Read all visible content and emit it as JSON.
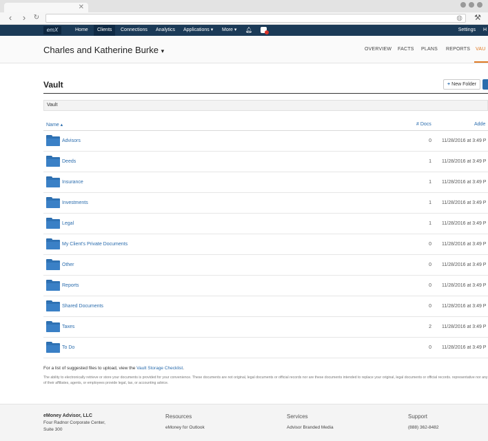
{
  "browser": {
    "address": "",
    "icons": {
      "back": "chevron-left-icon",
      "forward": "chevron-right-icon",
      "reload": "reload-icon",
      "globe": "globe-icon",
      "extension": "extension-icon"
    }
  },
  "topnav": {
    "logo": "emX",
    "items": [
      "Home",
      "Clients",
      "Connections",
      "Analytics",
      "Applications ▾",
      "More ▾"
    ],
    "active": "Clients",
    "settings": "Settings",
    "overflow": "H"
  },
  "client": {
    "name": "Charles and Katherine Burke",
    "tabs": [
      "OVERVIEW",
      "FACTS",
      "PLANS",
      "REPORTS",
      "VAU"
    ],
    "active_tab": "VAU"
  },
  "vault": {
    "title": "Vault",
    "new_folder_label": "New Folder",
    "breadcrumb": "Vault",
    "columns": {
      "name": "Name ▴",
      "docs": "# Docs",
      "added": "Adde"
    },
    "rows": [
      {
        "name": "Advisors",
        "docs": "0",
        "added": "11/28/2016 at 3:49 P"
      },
      {
        "name": "Deeds",
        "docs": "1",
        "added": "11/28/2016 at 3:49 P"
      },
      {
        "name": "Insurance",
        "docs": "1",
        "added": "11/28/2016 at 3:49 P"
      },
      {
        "name": "Investments",
        "docs": "1",
        "added": "11/28/2016 at 3:49 P"
      },
      {
        "name": "Legal",
        "docs": "1",
        "added": "11/28/2016 at 3:49 P"
      },
      {
        "name": "My Client's Private Documents",
        "docs": "0",
        "added": "11/28/2016 at 3:49 P"
      },
      {
        "name": "Other",
        "docs": "0",
        "added": "11/28/2016 at 3:49 P"
      },
      {
        "name": "Reports",
        "docs": "0",
        "added": "11/28/2016 at 3:49 P"
      },
      {
        "name": "Shared Documents",
        "docs": "0",
        "added": "11/28/2016 at 3:49 P"
      },
      {
        "name": "Taxes",
        "docs": "2",
        "added": "11/28/2016 at 3:49 P"
      },
      {
        "name": "To Do",
        "docs": "0",
        "added": "11/28/2016 at 3:49 P"
      }
    ],
    "checklist_prefix": "For a list of suggested files to upload, view the ",
    "checklist_link": "Vault Storage Checklist",
    "checklist_suffix": ".",
    "disclaimer": "The ability to electronically retrieve or store your documents is provided for your convenience. These documents are not original, legal documents or official records nor are these documents intended to replace your original, legal documents or official records. representative nor any of their affiliates, agents, or employees provide legal, tax, or accounting advice."
  },
  "footer": {
    "company": "eMoney Advisor, LLC",
    "address1": "Four Radnor Corporate Center,",
    "address2": "Suite 300",
    "resources_heading": "Resources",
    "resources_item": "eMoney for Outlook",
    "services_heading": "Services",
    "services_item": "Advisor Branded Media",
    "support_heading": "Support",
    "support_phone": "(888) 362-8482"
  },
  "colors": {
    "nav": "#1b3a57",
    "accent": "#e07a24",
    "link": "#2a6cad"
  }
}
